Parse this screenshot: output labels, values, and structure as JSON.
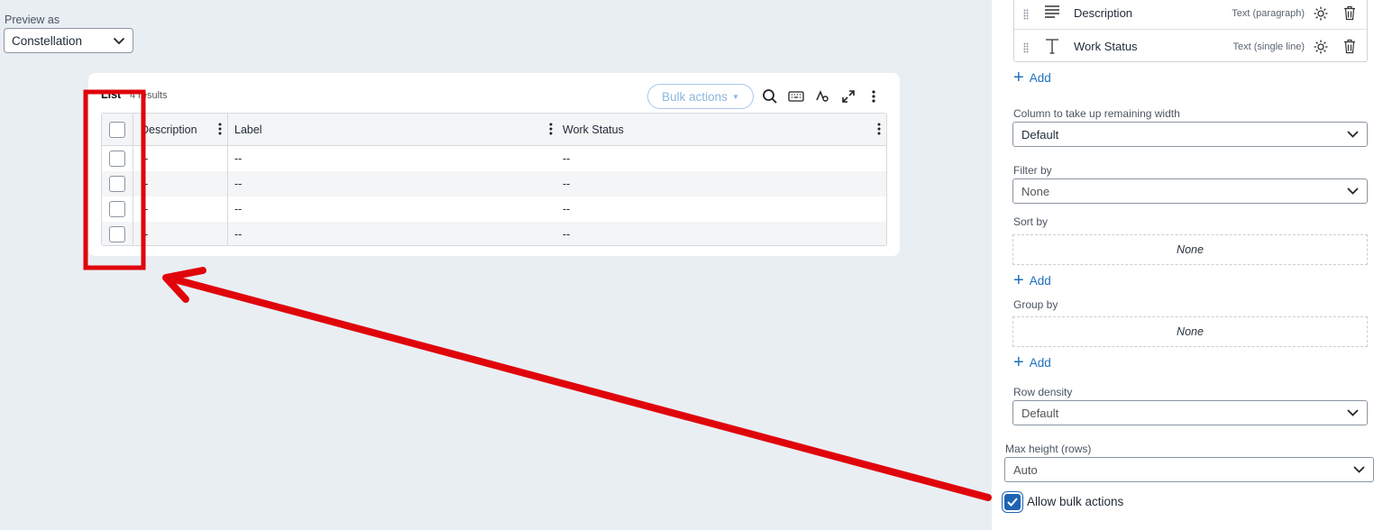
{
  "preview": {
    "label": "Preview as",
    "selected": "Constellation"
  },
  "list": {
    "title": "List",
    "count_text": "4 results",
    "bulk_actions_label": "Bulk actions",
    "columns": [
      "Description",
      "Label",
      "Work Status"
    ],
    "rows": [
      [
        "--",
        "--",
        "--"
      ],
      [
        "--",
        "--",
        "--"
      ],
      [
        "--",
        "--",
        "--"
      ],
      [
        "--",
        "--",
        "--"
      ]
    ],
    "toolbar_icons": [
      "search-icon",
      "keyboard-icon",
      "text-format-icon",
      "expand-icon",
      "more-vertical-icon"
    ]
  },
  "panel": {
    "fields": [
      {
        "name": "Description",
        "type": "Text (paragraph)",
        "icon": "paragraph-icon"
      },
      {
        "name": "Work Status",
        "type": "Text (single line)",
        "icon": "text-icon"
      }
    ],
    "add_label": "Add",
    "remaining_width": {
      "label": "Column to take up remaining width",
      "value": "Default"
    },
    "filter_by": {
      "label": "Filter by",
      "value": "None"
    },
    "sort_by": {
      "label": "Sort by",
      "value": "None"
    },
    "group_by": {
      "label": "Group by",
      "value": "None"
    },
    "row_density": {
      "label": "Row density",
      "value": "Default"
    },
    "max_height": {
      "label": "Max height (rows)",
      "value": "Auto"
    },
    "bulk_actions": {
      "label": "Allow bulk actions",
      "checked": true
    }
  },
  "colors": {
    "accent": "#1e6fc0",
    "annotation": "#e0040b",
    "background": "#e9eef3"
  }
}
